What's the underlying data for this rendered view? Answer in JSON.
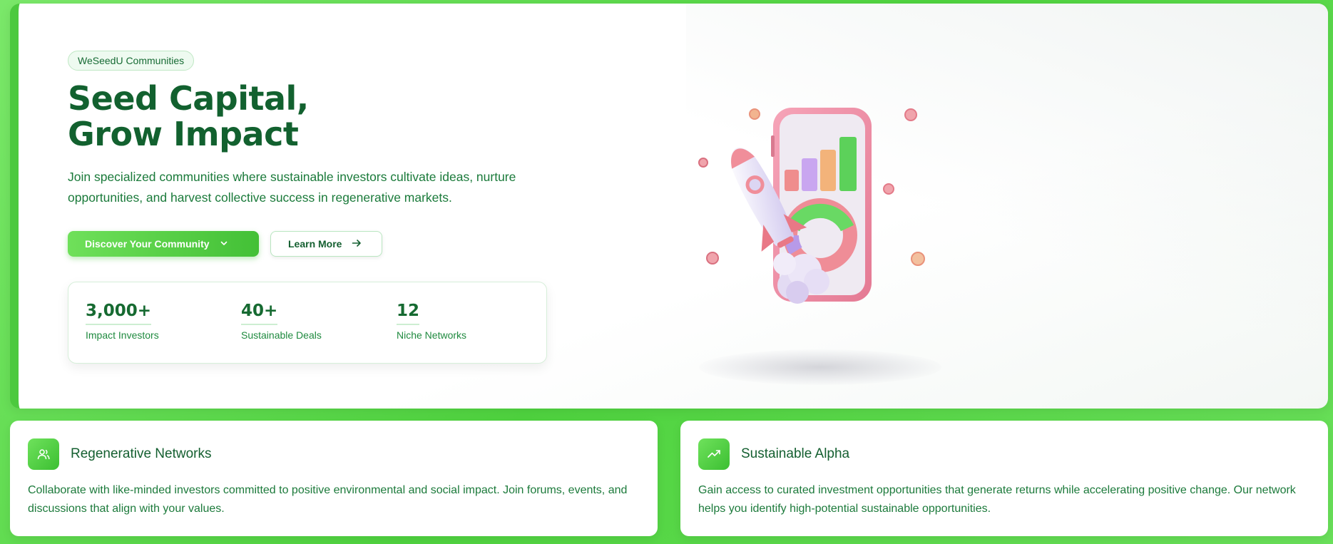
{
  "hero": {
    "badge": "WeSeedU Communities",
    "headline_line1": "Seed Capital,",
    "headline_line2": "Grow Impact",
    "lead": "Join specialized communities where sustainable investors cultivate ideas, nurture opportunities, and harvest collective success in regenerative markets.",
    "primary_button": "Discover Your Community",
    "secondary_button": "Learn More",
    "illustration": "rocket-phone-growth-chart-icon"
  },
  "stats": [
    {
      "value": "3,000+",
      "label": "Impact Investors"
    },
    {
      "value": "40+",
      "label": "Sustainable Deals"
    },
    {
      "value": "12",
      "label": "Niche Networks"
    }
  ],
  "cards": [
    {
      "icon": "users-icon",
      "title": "Regenerative Networks",
      "description": "Collaborate with like-minded investors committed to positive environmental and social impact. Join forums, events, and discussions that align with your values."
    },
    {
      "icon": "trending-up-icon",
      "title": "Sustainable Alpha",
      "description": "Gain access to curated investment opportunities that generate returns while accelerating positive change. Our network helps you identify high-potential sustainable opportunities."
    }
  ],
  "colors": {
    "brand_green": "#12612f",
    "accent_green": "#4cc93e",
    "page_background": "#5ad64a"
  }
}
